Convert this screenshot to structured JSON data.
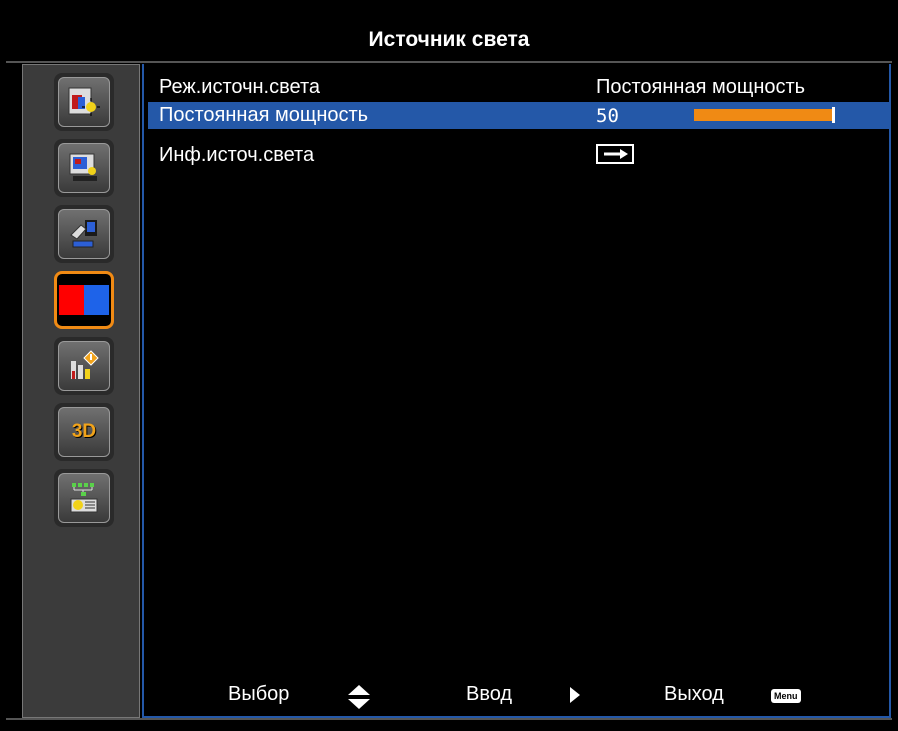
{
  "title": "Источник света",
  "menu_icons": [
    {
      "name": "picture-settings-icon"
    },
    {
      "name": "screen-settings-icon"
    },
    {
      "name": "setup-icon"
    },
    {
      "name": "light-source-icon",
      "selected": true
    },
    {
      "name": "information-icon"
    },
    {
      "name": "3d-icon",
      "label": "3D"
    },
    {
      "name": "network-icon"
    }
  ],
  "rows": [
    {
      "label": "Реж.источн.света",
      "value": "Постоянная мощность"
    },
    {
      "label": "Постоянная мощность",
      "value": "50",
      "progress": 50
    },
    {
      "label": "Инф.источ.света",
      "value_icon": "enter-arrow-icon"
    }
  ],
  "footer": {
    "select_label": "Выбор",
    "enter_label": "Ввод",
    "exit_label": "Выход",
    "menu_key": "Menu"
  },
  "colors": {
    "highlight": "#2458a8",
    "accent": "#f08a14",
    "sidebar": "#3b3b3b"
  }
}
